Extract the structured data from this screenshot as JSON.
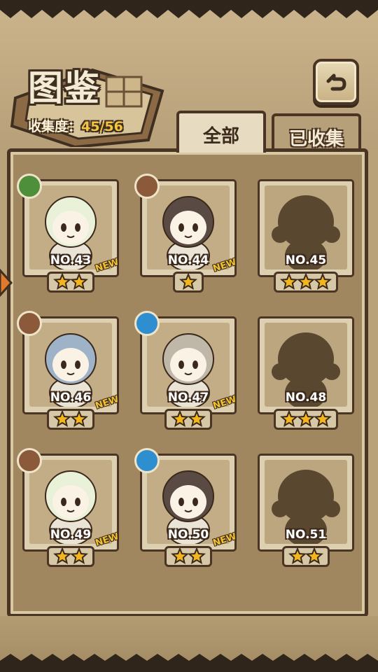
{
  "header": {
    "title": "图鉴",
    "collection_label": "收集度：",
    "collection_value": "45/56"
  },
  "tabs": [
    {
      "label": "全部",
      "active": true
    },
    {
      "label": "已收集",
      "active": false
    }
  ],
  "cards": [
    {
      "number": "NO.43",
      "stars": 2,
      "new": true,
      "new_label": "NEW",
      "element": "leaf",
      "unlocked": true
    },
    {
      "number": "NO.44",
      "stars": 1,
      "new": true,
      "new_label": "NEW",
      "element": "earth",
      "unlocked": true
    },
    {
      "number": "NO.45",
      "stars": 3,
      "new": false,
      "element": "none",
      "unlocked": false
    },
    {
      "number": "NO.46",
      "stars": 2,
      "new": true,
      "new_label": "NEW",
      "element": "earth",
      "unlocked": true
    },
    {
      "number": "NO.47",
      "stars": 2,
      "new": true,
      "new_label": "NEW",
      "element": "water",
      "unlocked": true
    },
    {
      "number": "NO.48",
      "stars": 3,
      "new": false,
      "element": "none",
      "unlocked": false
    },
    {
      "number": "NO.49",
      "stars": 2,
      "new": true,
      "new_label": "NEW",
      "element": "earth",
      "unlocked": true
    },
    {
      "number": "NO.50",
      "stars": 2,
      "new": true,
      "new_label": "NEW",
      "element": "water",
      "unlocked": true
    },
    {
      "number": "NO.51",
      "stars": 2,
      "new": false,
      "element": "none",
      "unlocked": false
    }
  ],
  "colors": {
    "star": "#f2b51d",
    "silhouette": "#5a4730",
    "accent": "#f6c53f"
  },
  "icons": {
    "back": "back-arrow-icon",
    "scroll_left": "left-arrow-icon"
  }
}
